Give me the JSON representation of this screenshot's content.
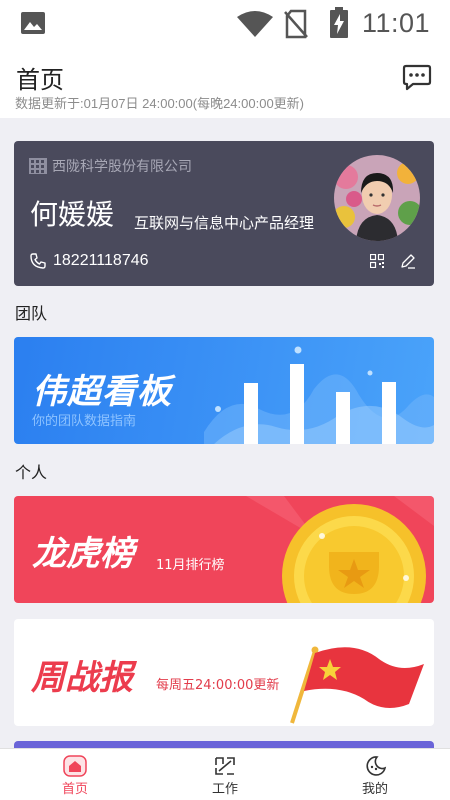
{
  "status_bar": {
    "time": "11:01",
    "icons": [
      "gallery-icon",
      "wifi-icon",
      "no-sim-icon",
      "battery-charging-icon"
    ]
  },
  "header": {
    "title": "首页",
    "update_info": "数据更新于:01月07日 24:00:00(每晚24:00:00更新)",
    "message_icon": "chat-bubble-icon"
  },
  "profile": {
    "company": "西陇科学股份有限公司",
    "name": "何媛媛",
    "position": "互联网与信息中心产品经理",
    "phone": "18221118746",
    "icons": [
      "building-icon",
      "phone-icon",
      "qr-code-icon",
      "edit-icon"
    ]
  },
  "sections": {
    "team": "团队",
    "personal": "个人"
  },
  "banners": {
    "team_board": {
      "title": "伟超看板",
      "subtitle": "你的团队数据指南"
    },
    "ranking": {
      "title": "龙虎榜",
      "subtitle": "11月排行榜"
    },
    "weekly": {
      "title": "周战报",
      "subtitle": "每周五24:00:00更新"
    }
  },
  "tabbar": {
    "items": [
      {
        "label": "首页",
        "icon": "home-icon",
        "active": true
      },
      {
        "label": "工作",
        "icon": "work-icon",
        "active": false
      },
      {
        "label": "我的",
        "icon": "profile-moon-icon",
        "active": false
      }
    ]
  },
  "colors": {
    "accent": "#f0455a",
    "card_bg": "#4a4a5c",
    "team_blue": "#2b7ff0",
    "rank_red": "#f0455a",
    "page_bg": "#efeff4"
  }
}
